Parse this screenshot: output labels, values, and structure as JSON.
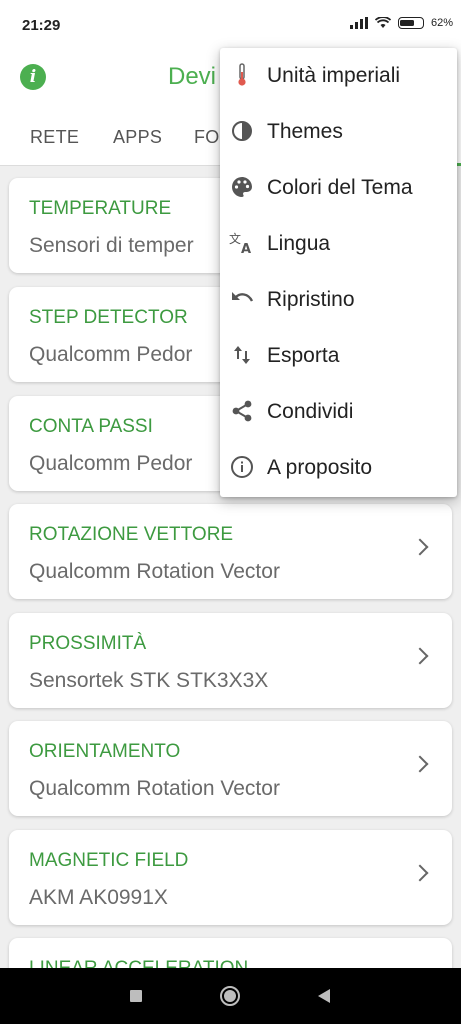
{
  "status_bar": {
    "time": "21:29",
    "battery": "62"
  },
  "app_bar": {
    "title": "Devi"
  },
  "tabs": [
    {
      "label": "RETE"
    },
    {
      "label": "APPS"
    },
    {
      "label": "FO"
    }
  ],
  "cards": [
    {
      "title": "TEMPERATURE",
      "subtitle": "Sensori di temper"
    },
    {
      "title": "STEP DETECTOR",
      "subtitle": "Qualcomm Pedor"
    },
    {
      "title": "CONTA PASSI",
      "subtitle": "Qualcomm Pedor"
    },
    {
      "title": "ROTAZIONE VETTORE",
      "subtitle": "Qualcomm Rotation Vector"
    },
    {
      "title": "PROSSIMITÀ",
      "subtitle": "Sensortek STK STK3X3X"
    },
    {
      "title": "ORIENTAMENTO",
      "subtitle": "Qualcomm Rotation Vector"
    },
    {
      "title": "MAGNETIC FIELD",
      "subtitle": "AKM AK0991X"
    },
    {
      "title": "LINEAR ACCELERATION",
      "subtitle": ""
    }
  ],
  "menu": {
    "items": [
      {
        "label": "Unità imperiali",
        "icon": "thermometer-icon"
      },
      {
        "label": "Themes",
        "icon": "contrast-icon"
      },
      {
        "label": "Colori del Tema",
        "icon": "palette-icon"
      },
      {
        "label": "Lingua",
        "icon": "translate-icon"
      },
      {
        "label": "Ripristino",
        "icon": "undo-icon"
      },
      {
        "label": "Esporta",
        "icon": "import-export-icon"
      },
      {
        "label": "Condividi",
        "icon": "share-icon"
      },
      {
        "label": "A proposito",
        "icon": "info-outline-icon"
      }
    ]
  },
  "colors": {
    "accent": "#4caf50",
    "card_title": "#3d9a40"
  }
}
